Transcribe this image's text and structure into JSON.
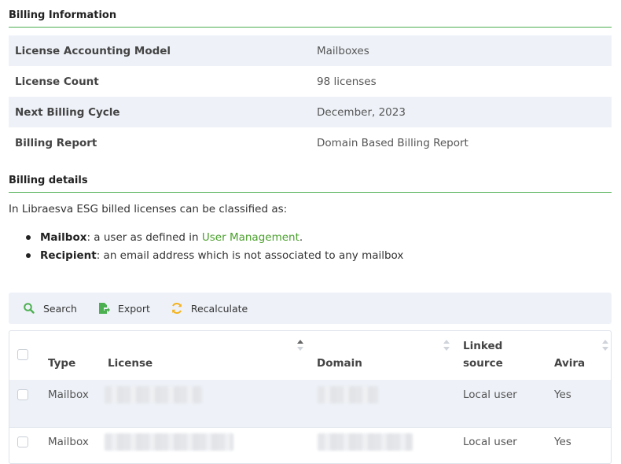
{
  "billing_information": {
    "title": "Billing Information",
    "rows": [
      {
        "label": "License Accounting Model",
        "value": "Mailboxes"
      },
      {
        "label": "License Count",
        "value": "98 licenses"
      },
      {
        "label": "Next Billing Cycle",
        "value": "December, 2023"
      },
      {
        "label": "Billing Report",
        "value": "Domain Based Billing Report"
      }
    ]
  },
  "billing_details": {
    "title": "Billing details",
    "intro": "In Libraesva ESG billed licenses can be classified as:",
    "mailbox_term": "Mailbox",
    "mailbox_text": ": a user as defined in ",
    "mailbox_link": "User Management",
    "mailbox_end": ".",
    "recipient_term": "Recipient",
    "recipient_text": ": an email address which is not associated to any mailbox"
  },
  "toolbar": {
    "search": "Search",
    "export": "Export",
    "recalculate": "Recalculate"
  },
  "table": {
    "headers": {
      "type": "Type",
      "license": "License",
      "domain": "Domain",
      "linked_line1": "Linked",
      "linked_line2": "source",
      "avira": "Avira"
    },
    "rows": [
      {
        "type": "Mailbox",
        "linked_source": "Local user",
        "avira": "Yes"
      },
      {
        "type": "Mailbox",
        "linked_source": "Local user",
        "avira": "Yes"
      }
    ]
  },
  "colors": {
    "accent_green": "#4aa02c",
    "row_alt": "#eef2f8",
    "export_icon": "#4caf50",
    "recalc_icon": "#f5b21b"
  }
}
